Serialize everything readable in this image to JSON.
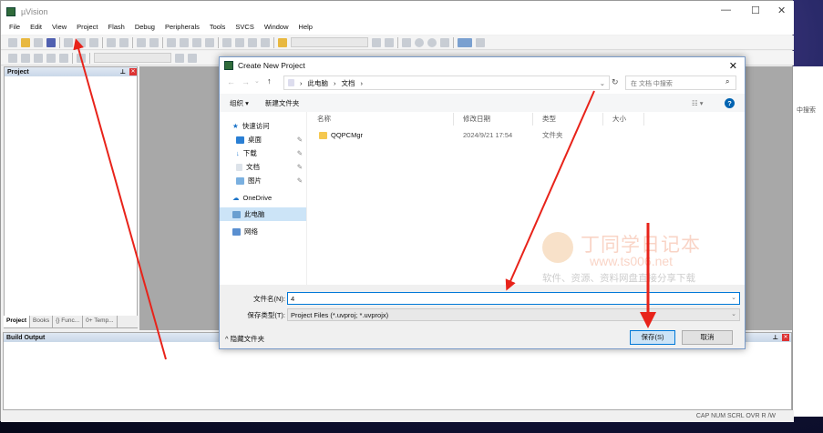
{
  "app": {
    "title": "µVision"
  },
  "menu": [
    "File",
    "Edit",
    "View",
    "Project",
    "Flash",
    "Debug",
    "Peripherals",
    "Tools",
    "SVCS",
    "Window",
    "Help"
  ],
  "project_panel": {
    "title": "Project",
    "tabs": [
      "Project",
      "Books",
      "{} Func...",
      "0+ Temp..."
    ]
  },
  "build_output": {
    "title": "Build Output"
  },
  "status_bar": "CAP  NUM  SCRL  OVR  R /W",
  "background_window": {
    "search_text": "中搜索"
  },
  "dialog": {
    "title": "Create New Project",
    "breadcrumb": [
      "此电脑",
      "文档"
    ],
    "search_placeholder": "在 文档 中搜索",
    "organize": "组织 ▾",
    "new_folder": "新建文件夹",
    "nav": {
      "quick_access": "快速访问",
      "items": [
        "桌面",
        "下载",
        "文档",
        "图片"
      ],
      "onedrive": "OneDrive",
      "this_pc": "此电脑",
      "network": "网络"
    },
    "columns": [
      "名称",
      "修改日期",
      "类型",
      "大小"
    ],
    "files": [
      {
        "name": "QQPCMgr",
        "modified": "2024/9/21 17:54",
        "type": "文件夹",
        "size": ""
      }
    ],
    "filename_label": "文件名(N):",
    "filename_value": "4",
    "filetype_label": "保存类型(T):",
    "filetype_value": "Project Files (*.uvproj; *.uvprojx)",
    "hide_folders": "隐藏文件夹",
    "save": "保存(S)",
    "cancel": "取消"
  },
  "watermark": {
    "title": "丁同学日记本",
    "url": "www.ts006.net",
    "slogan": "软件、资源、资料网盘直接分享下载"
  },
  "colors": {
    "arrow": "#e8231a",
    "accent": "#0078d7"
  }
}
